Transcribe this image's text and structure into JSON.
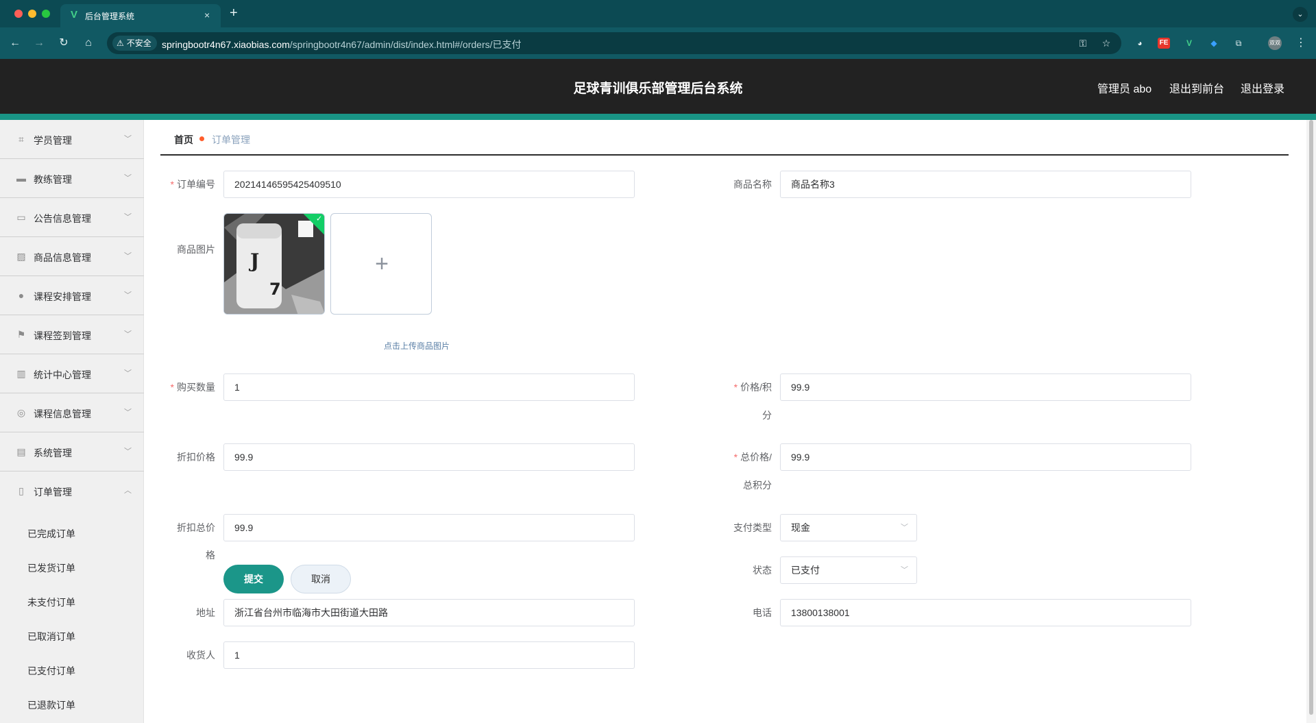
{
  "browser": {
    "tab_title": "后台管理系统",
    "tab_favicon": "V",
    "new_tab": "+",
    "tab_close": "×",
    "security_label": "不安全",
    "url_host": "springbootr4n67.xiaobias.com",
    "url_path": "/springbootr4n67/admin/dist/index.html#/orders/已支付",
    "profile_label": "双双",
    "extension_fe": "FE",
    "extension_v": "V"
  },
  "header": {
    "title": "足球青训俱乐部管理后台系统",
    "user": "管理员 abo",
    "to_front": "退出到前台",
    "logout": "退出登录"
  },
  "sidebar": {
    "items": [
      {
        "label": "学员管理",
        "icon": "crop-icon"
      },
      {
        "label": "教练管理",
        "icon": "briefcase-icon"
      },
      {
        "label": "公告信息管理",
        "icon": "notice-card-icon"
      },
      {
        "label": "商品信息管理",
        "icon": "chart-icon"
      },
      {
        "label": "课程安排管理",
        "icon": "user-icon"
      },
      {
        "label": "课程签到管理",
        "icon": "flag-icon"
      },
      {
        "label": "统计中心管理",
        "icon": "bar-chart-icon"
      },
      {
        "label": "课程信息管理",
        "icon": "compass-icon"
      },
      {
        "label": "系统管理",
        "icon": "clipboard-icon"
      },
      {
        "label": "订单管理",
        "icon": "order-icon",
        "expanded": true
      }
    ],
    "sub_items": [
      "已完成订单",
      "已发货订单",
      "未支付订单",
      "已取消订单",
      "已支付订单",
      "已退款订单"
    ]
  },
  "breadcrumb": {
    "home": "首页",
    "current": "订单管理"
  },
  "form": {
    "order_no_label": "订单编号",
    "order_no": "20214146595425409510",
    "product_name_label": "商品名称",
    "product_name": "商品名称3",
    "product_image_label": "商品图片",
    "upload_tip": "点击上传商品图片",
    "jersey_number": "7",
    "quantity_label": "购买数量",
    "quantity": "1",
    "price_label_1": "价格/积",
    "price_label_2": "分",
    "price": "99.9",
    "discount_price_label": "折扣价格",
    "discount_price": "99.9",
    "total_label_1": "总价格/",
    "total_label_2": "总积分",
    "total": "99.9",
    "discount_total_label_1": "折扣总价",
    "discount_total_label_2": "格",
    "discount_total": "99.9",
    "pay_type_label": "支付类型",
    "pay_type": "现金",
    "status_label": "状态",
    "status": "已支付",
    "address_label": "地址",
    "address": "浙江省台州市临海市大田街道大田路",
    "phone_label": "电话",
    "phone": "13800138001",
    "receiver_label": "收货人",
    "receiver": "1",
    "submit": "提交",
    "cancel": "取消"
  },
  "colors": {
    "accent": "#199586",
    "header_bg": "#222222",
    "required": "#f56c6c",
    "breadcrumb_dot": "#ff5d2c"
  }
}
